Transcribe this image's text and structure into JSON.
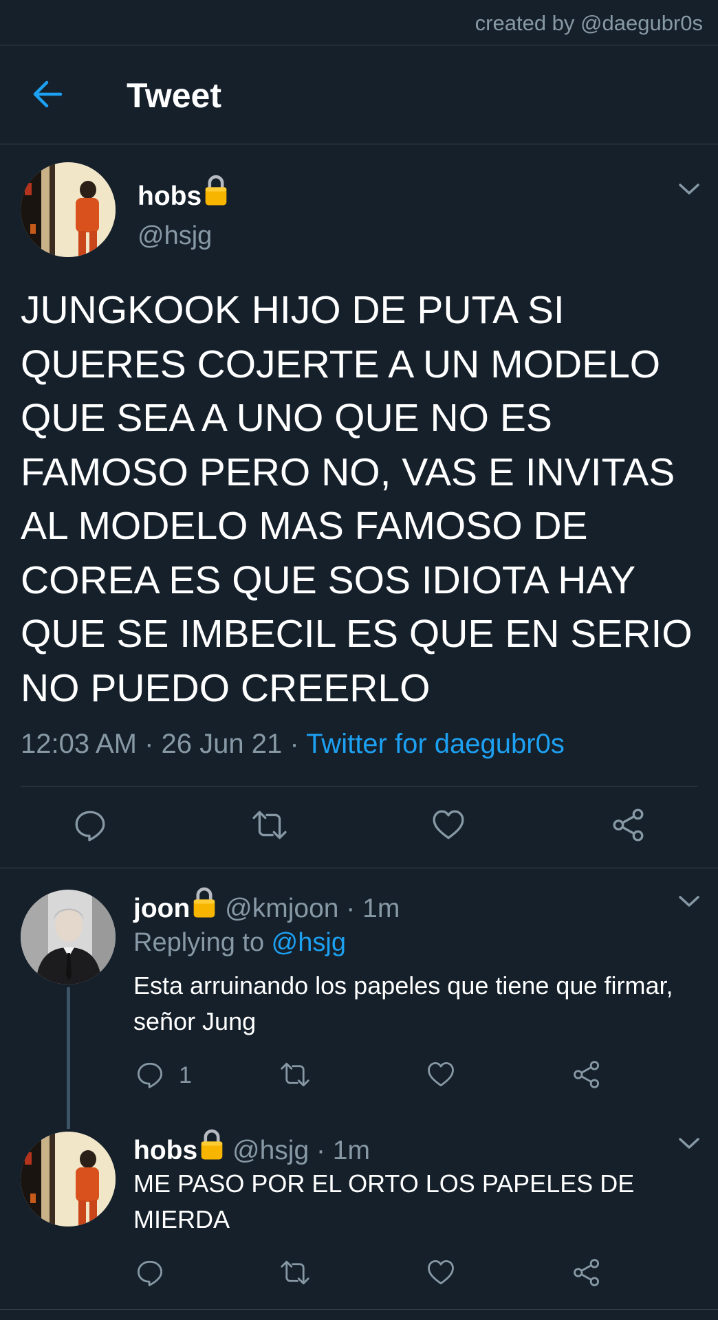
{
  "credit": "created by @daegubr0s",
  "header": {
    "title": "Tweet"
  },
  "main_tweet": {
    "name": "hobs",
    "handle": "@hsjg",
    "text": "JUNGKOOK HIJO DE PUTA SI QUERES COJERTE A UN MODELO QUE SEA A UNO QUE NO ES FAMOSO PERO NO, VAS E INVITAS AL MODELO MAS FAMOSO DE COREA ES QUE SOS IDIOTA HAY QUE SE IMBECIL ES QUE EN SERIO NO PUEDO CREERLO",
    "time": "12:03 AM · 26 Jun 21 · ",
    "source": "Twitter for daegubr0s"
  },
  "replies": [
    {
      "name": "joon",
      "handle": "@kmjoon · 1m",
      "replying_prefix": "Replying to ",
      "replying_to": "@hsjg",
      "text": "Esta arruinando los papeles que tiene que firmar, señor Jung",
      "reply_count": "1"
    },
    {
      "name": "hobs",
      "handle": "@hsjg · 1m",
      "text": "ME PASO POR EL ORTO LOS PAPELES DE MIERDA"
    }
  ],
  "icons": {
    "back": "arrow-left-icon",
    "lock": "lock-icon",
    "chevron": "chevron-down-icon",
    "reply": "reply-icon",
    "retweet": "retweet-icon",
    "like": "like-icon",
    "share": "share-icon"
  },
  "colors": {
    "background": "#15202b",
    "accent": "#1da1f2",
    "secondary_text": "#8899a6",
    "divider": "#38444d"
  }
}
